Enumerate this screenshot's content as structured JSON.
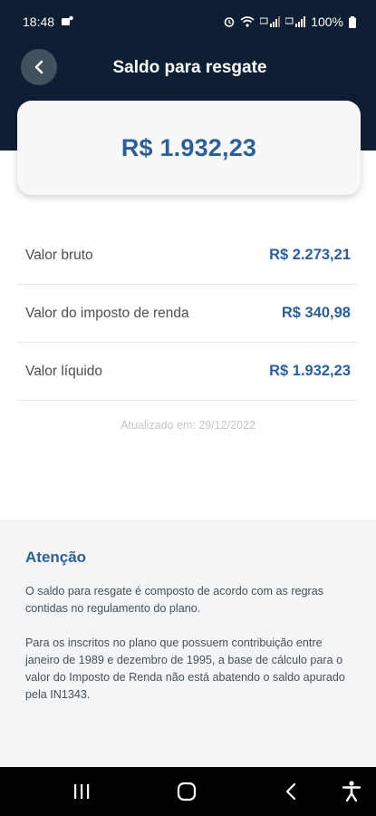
{
  "status_bar": {
    "time": "18:48",
    "battery": "100%",
    "icons": [
      "alarm-icon",
      "wifi-icon",
      "signal-icon",
      "signal-icon",
      "battery-icon"
    ]
  },
  "header": {
    "title": "Saldo para resgate",
    "back_icon": "chevron-left-icon"
  },
  "balance": {
    "value": "R$ 1.932,23"
  },
  "details": [
    {
      "label": "Valor bruto",
      "value": "R$ 2.273,21"
    },
    {
      "label": "Valor do imposto de renda",
      "value": "R$ 340,98"
    },
    {
      "label": "Valor líquido",
      "value": "R$ 1.932,23"
    }
  ],
  "updated_text": "Atualizado em: 29/12/2022",
  "attention": {
    "title": "Atenção",
    "paragraphs": [
      "O saldo para resgate é composto de acordo com as regras contidas no regulamento do plano.",
      "Para os inscritos no plano que possuem contribuição entre janeiro de 1989 e dezembro de 1995, a base de cálculo para o valor do Imposto de Renda não está abatendo o saldo apurado pela IN1343."
    ]
  },
  "nav_bar": {
    "items": [
      "recent-apps-icon",
      "home-icon",
      "back-icon",
      "accessibility-icon"
    ]
  },
  "colors": {
    "header_bg": "#0e1f33",
    "accent": "#2c5f97",
    "notice_bg": "#f4f5f7"
  }
}
